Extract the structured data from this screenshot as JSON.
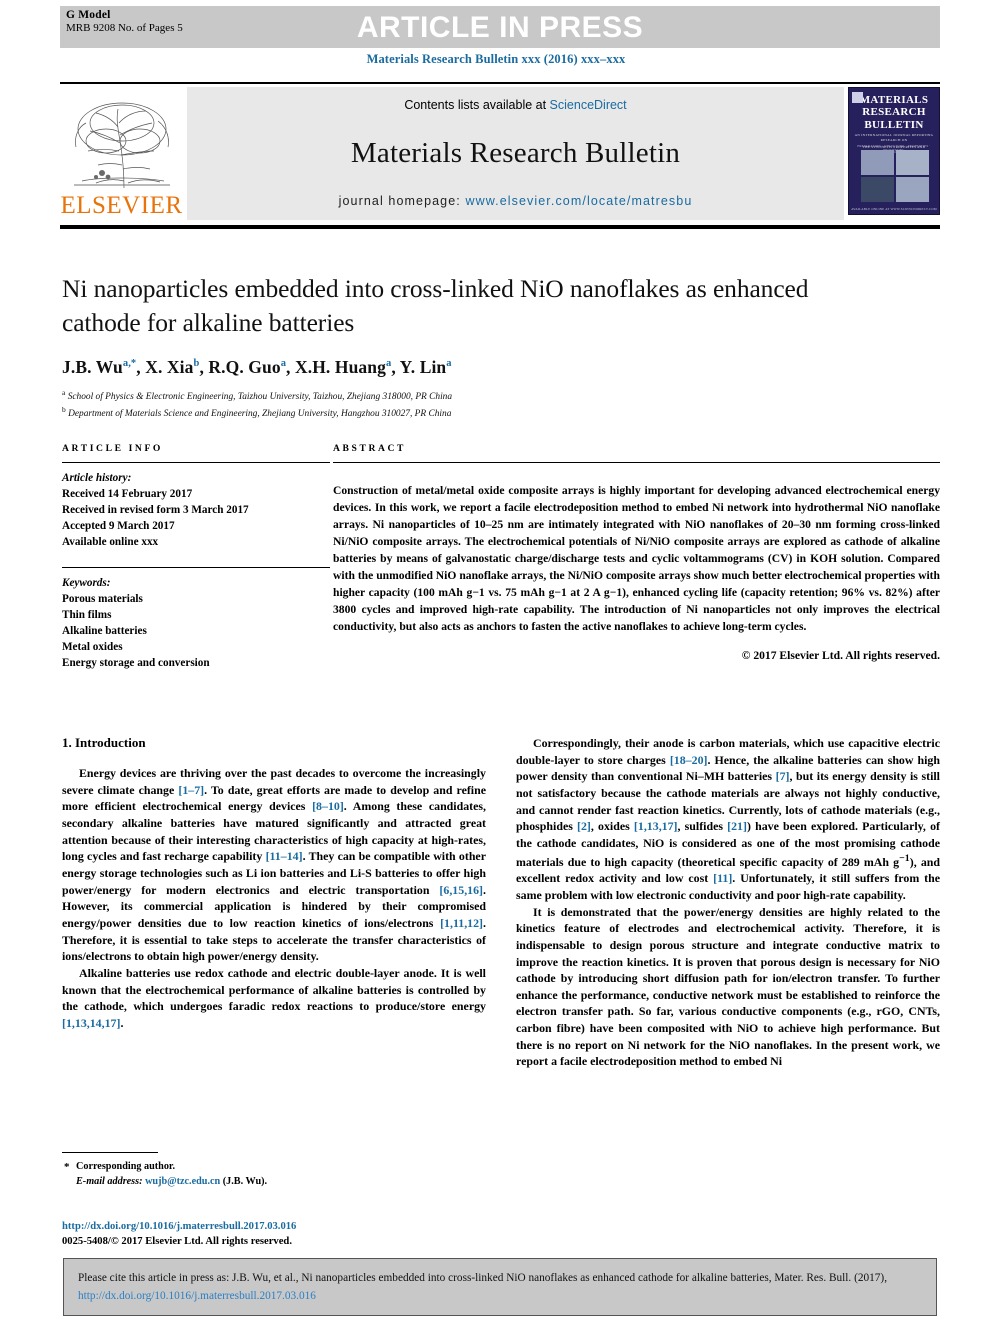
{
  "header": {
    "g_model_line1": "G Model",
    "g_model_line2": "MRB 9208 No. of Pages 5",
    "article_in_press": "ARTICLE IN PRESS",
    "journal_citation": "Materials Research Bulletin xxx (2016) xxx–xxx"
  },
  "masthead": {
    "contents_prefix": "Contents lists available at ",
    "sciencedirect": "ScienceDirect",
    "journal_title": "Materials Research Bulletin",
    "homepage_prefix": "journal homepage: ",
    "homepage_url": "www.elsevier.com/locate/matresbu",
    "elsevier_wordmark": "ELSEVIER",
    "cover_title_line1": "MATERIALS",
    "cover_title_line2": "RESEARCH",
    "cover_title_line3": "BULLETIN",
    "cover_subtitle": "AN INTERNATIONAL JOURNAL REPORTING RESEARCH ON",
    "cover_subtitle2": "THE SYNTHESIS PROPERTIES AND APPLICATIONS OF MATERIALS",
    "cover_band": "PREPARATION · STRUCTURE · PROPERTIES · PROCESSING",
    "cover_footer": "AVAILABLE ONLINE AT WWW.SCIENCEDIRECT.COM"
  },
  "article": {
    "title": "Ni nanoparticles embedded into cross-linked NiO nanoflakes as enhanced cathode for alkaline batteries",
    "authors_html": "J.B. Wu<sup>a,*</sup>, X. Xia<sup>b</sup>, R.Q. Guo<sup>a</sup>, X.H. Huang<sup>a</sup>, Y. Lin<sup>a</sup>",
    "affiliation_a": "School of Physics & Electronic Engineering, Taizhou University, Taizhou, Zhejiang 318000, PR China",
    "affiliation_b": "Department of Materials Science and Engineering, Zhejiang University, Hangzhou 310027, PR China"
  },
  "info": {
    "section_label": "ARTICLE INFO",
    "history_label": "Article history:",
    "history": [
      "Received 14 February 2017",
      "Received in revised form 3 March 2017",
      "Accepted 9 March 2017",
      "Available online xxx"
    ],
    "keywords_label": "Keywords:",
    "keywords": [
      "Porous materials",
      "Thin films",
      "Alkaline batteries",
      "Metal oxides",
      "Energy storage and conversion"
    ]
  },
  "abstract": {
    "section_label": "ABSTRACT",
    "text": "Construction of metal/metal oxide composite arrays is highly important for developing advanced electrochemical energy devices. In this work, we report a facile electrodeposition method to embed Ni network into hydrothermal NiO nanoflake arrays. Ni nanoparticles of 10–25 nm are intimately integrated with NiO nanoflakes of 20–30 nm forming cross-linked Ni/NiO composite arrays. The electrochemical potentials of Ni/NiO composite arrays are explored as cathode of alkaline batteries by means of galvanostatic charge/discharge tests and cyclic voltammograms (CV) in KOH solution. Compared with the unmodified NiO nanoflake arrays, the Ni/NiO composite arrays show much better electrochemical properties with higher capacity (100 mAh g−1 vs. 75 mAh g−1 at 2 A g−1), enhanced cycling life (capacity retention; 96% vs. 82%) after 3800 cycles and improved high-rate capability. The introduction of Ni nanoparticles not only improves the electrical conductivity, but also acts as anchors to fasten the active nanoflakes to achieve long-term cycles.",
    "copyright": "© 2017 Elsevier Ltd. All rights reserved."
  },
  "body": {
    "section_heading": "1. Introduction",
    "left_paragraphs_html": [
      "Energy devices are thriving over the past decades to overcome the increasingly severe climate change <span class=\"ref\">[1–7]</span>. To date, great efforts are made to develop and refine more efficient electrochemical energy devices <span class=\"ref\">[8–10]</span>. Among these candidates, secondary alkaline batteries have matured significantly and attracted great attention because of their interesting characteristics of high capacity at high-rates, long cycles and fast recharge capability <span class=\"ref\">[11–14]</span>. They can be compatible with other energy storage technologies such as Li ion batteries and Li-S batteries to offer high power/energy for modern electronics and electric transportation <span class=\"ref\">[6,15,16]</span>. However, its commercial application is hindered by their compromised energy/power densities due to low reaction kinetics of ions/electrons <span class=\"ref\">[1,11,12]</span>. Therefore, it is essential to take steps to accelerate the transfer characteristics of ions/electrons to obtain high power/energy density.",
      "Alkaline batteries use redox cathode and electric double-layer anode. It is well known that the electrochemical performance of alkaline batteries is controlled by the cathode, which undergoes faradic redox reactions to produce/store energy <span class=\"ref\">[1,13,14,17]</span>."
    ],
    "right_paragraphs_html": [
      "Correspondingly, their anode is carbon materials, which use capacitive electric double-layer to store charges <span class=\"ref\">[18–20]</span>. Hence, the alkaline batteries can show high power density than conventional Ni–MH batteries <span class=\"ref\">[7]</span>, but its energy density is still not satisfactory because the cathode materials are always not highly conductive, and cannot render fast reaction kinetics. Currently, lots of cathode materials (e.g., phosphides <span class=\"ref\">[2]</span>, oxides <span class=\"ref\">[1,13,17]</span>, sulfides <span class=\"ref\">[21]</span>) have been explored. Particularly, of the cathode candidates, NiO is considered as one of the most promising cathode materials due to high capacity (theoretical specific capacity of 289 mAh g<sup>−1</sup>), and excellent redox activity and low cost <span class=\"ref\">[11]</span>. Unfortunately, it still suffers from the same problem with low electronic conductivity and poor high-rate capability.",
      "It is demonstrated that the power/energy densities are highly related to the kinetics feature of electrodes and electrochemical activity. Therefore, it is indispensable to design porous structure and integrate conductive matrix to improve the reaction kinetics. It is proven that porous design is necessary for NiO cathode by introducing short diffusion path for ion/electron transfer. To further enhance the performance, conductive network must be established to reinforce the electron transfer path. So far, various conductive components (e.g., rGO, CNTs, carbon fibre) have been composited with NiO to achieve high performance. But there is no report on Ni network for the NiO nanoflakes. In the present work, we report a facile electrodeposition method to embed Ni"
    ]
  },
  "footnote": {
    "star": "*",
    "corresponding": "Corresponding author.",
    "email_label": "E-mail address:",
    "email": "wujb@tzc.edu.cn",
    "email_owner": "(J.B. Wu).",
    "doi_url": "http://dx.doi.org/10.1016/j.materresbull.2017.03.016",
    "issn_line": "0025-5408/© 2017 Elsevier Ltd. All rights reserved."
  },
  "cite_box": {
    "prefix": "Please cite this article in press as: J.B. Wu, et al., Ni nanoparticles embedded into cross-linked NiO nanoflakes as enhanced cathode for alkaline batteries, Mater. Res. Bull. (2017), ",
    "link": "http://dx.doi.org/10.1016/j.materresbull.2017.03.016"
  },
  "colors": {
    "link_blue": "#1a6ba0",
    "elsevier_orange": "#e8730a",
    "banner_grey": "#c8c8c8",
    "masthead_grey": "#e8e8e8",
    "cover_navy": "#26215c"
  }
}
